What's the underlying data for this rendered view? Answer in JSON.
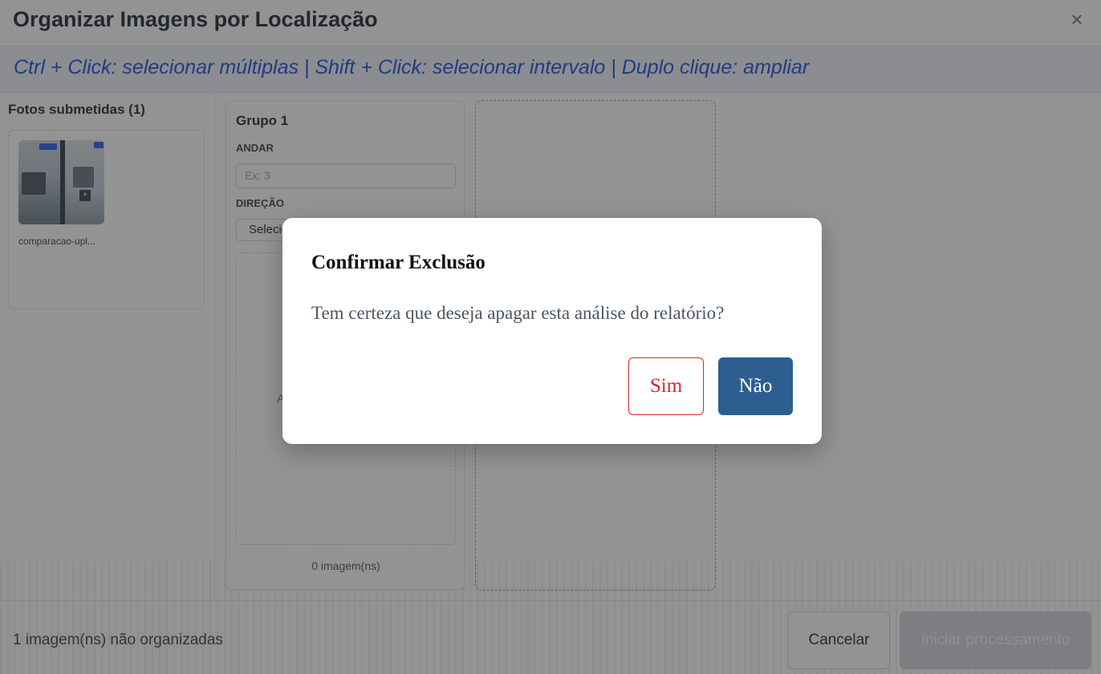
{
  "header": {
    "title": "Organizar Imagens por Localização",
    "close_icon": "close-icon",
    "close_glyph": "×"
  },
  "hint": {
    "text": "Ctrl + Click: selecionar múltiplas | Shift + Click: selecionar intervalo | Duplo clique: ampliar"
  },
  "left_panel": {
    "title": "Fotos submetidas (1)",
    "photos": [
      {
        "name": "comparacao-upl...",
        "plus_glyph": "+"
      }
    ]
  },
  "group": {
    "title": "Grupo 1",
    "floor_label": "ANDAR",
    "floor_placeholder": "Ex: 3",
    "direction_label": "DIREÇÃO",
    "direction_value": "Selecionar",
    "drop_hint": "A",
    "count": "0 imagem(ns)"
  },
  "footer": {
    "status": "1 imagem(ns) não organizadas",
    "cancel_label": "Cancelar",
    "start_label": "Iniciar processamento"
  },
  "modal": {
    "title": "Confirmar Exclusão",
    "message": "Tem certeza que deseja apagar esta análise do relatório?",
    "yes_label": "Sim",
    "no_label": "Não"
  },
  "colors": {
    "accent": "#1d4ed8",
    "primary_button": "#2c5f8f",
    "danger": "#dc2626",
    "overlay": "rgba(40,40,40,0.5)"
  }
}
